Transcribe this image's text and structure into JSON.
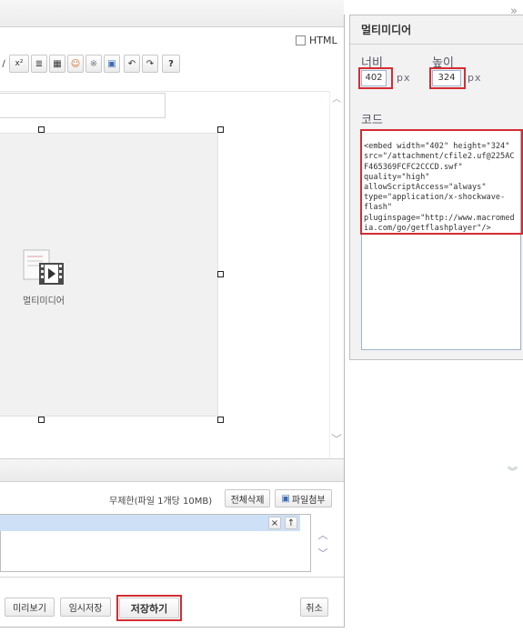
{
  "editor": {
    "html_mode_label": "HTML",
    "collapse_icon": "double-chevron-right",
    "toolbar": [
      {
        "name": "chevron-fragment-icon",
        "glyph": "∕"
      },
      {
        "name": "superscript-button",
        "glyph": "x²"
      },
      {
        "name": "align-icon",
        "glyph": "≣"
      },
      {
        "name": "table-icon",
        "glyph": "▦"
      },
      {
        "name": "emoticon-icon",
        "glyph": "☺"
      },
      {
        "name": "special-char-icon",
        "glyph": "※"
      },
      {
        "name": "save-disk-icon",
        "glyph": "▣"
      },
      {
        "name": "undo-icon",
        "glyph": "↶"
      },
      {
        "name": "redo-icon",
        "glyph": "↷"
      },
      {
        "name": "help-icon",
        "glyph": "?"
      }
    ],
    "media_caption": "멀티미디어"
  },
  "attachments": {
    "info": "무제한(파일 1개당 10MB)",
    "delete_all_label": "전체삭제",
    "attach_label": "파일첨부"
  },
  "actions": {
    "preview_label": "미리보기",
    "temp_save_label": "임시저장",
    "save_label": "저장하기",
    "cancel_label": "취소"
  },
  "panel": {
    "title": "멀티미디어",
    "width_label": "너비",
    "height_label": "높이",
    "width_value": "402",
    "height_value": "324",
    "unit": "px",
    "code_label": "코드",
    "code_lines": [
      "<embed width=\"402\" height=\"324\"",
      "src=\"/attachment/cfile2.uf@225AC",
      "F465369FCFC2CCCD.swf\"",
      "quality=\"high\"",
      "allowScriptAccess=\"always\"",
      "type=\"application/x-shockwave-",
      "flash\"",
      "pluginspage=\"http://www.macromed",
      "ia.com/go/getflashplayer\"/>"
    ]
  },
  "colors": {
    "highlight": "#d42c33",
    "selection_row": "#cde0f6",
    "panel_bg": "#f2f2f2"
  }
}
